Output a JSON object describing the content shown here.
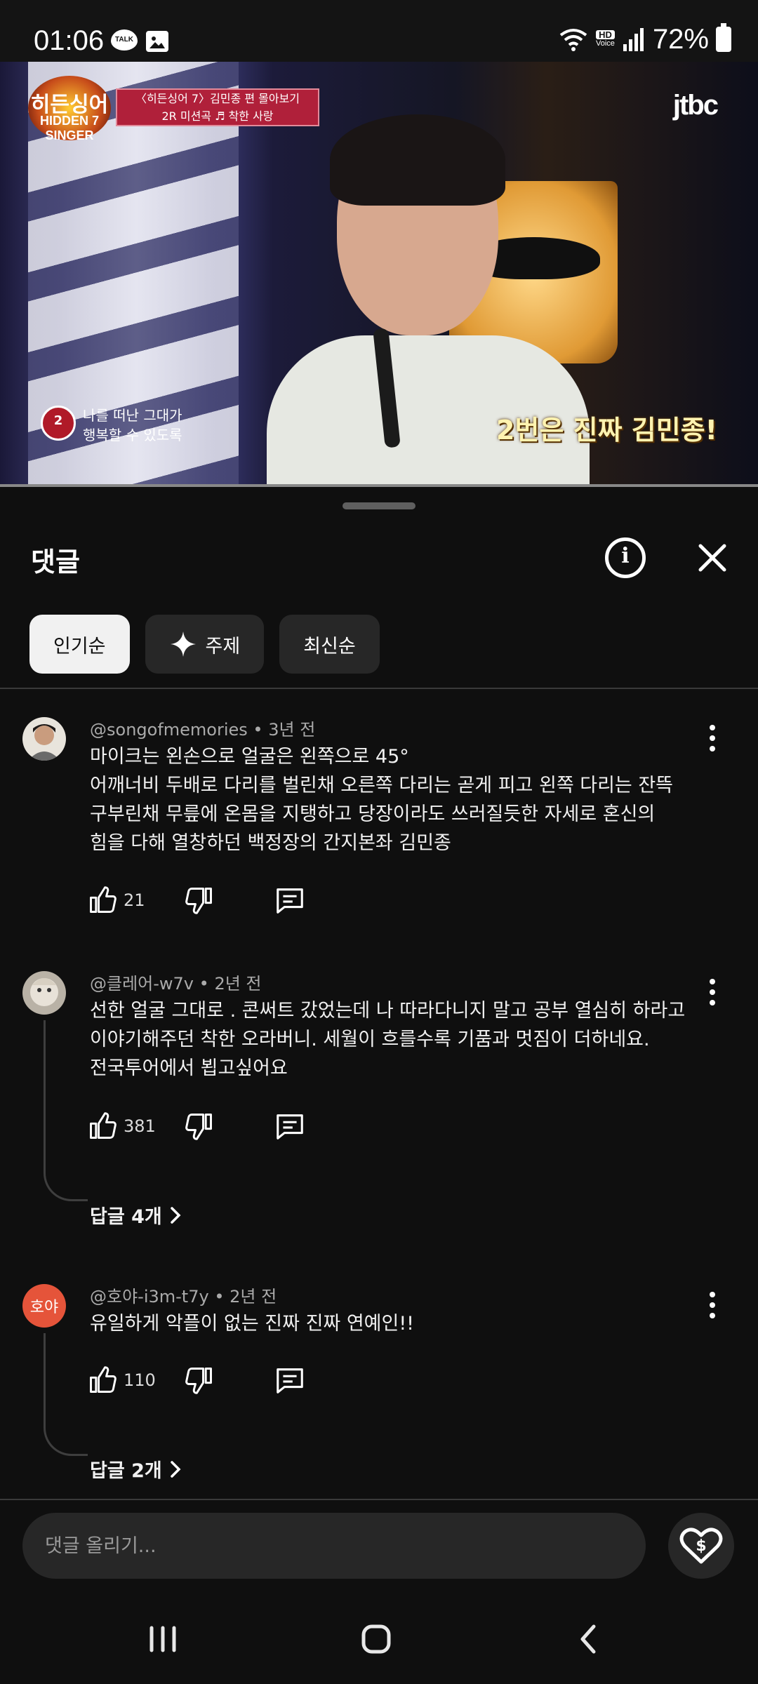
{
  "status_bar": {
    "time": "01:06",
    "talk_badge": "TALK",
    "hd_voice": "HD Voice",
    "battery": "72%"
  },
  "video": {
    "show_logo_line1": "히든싱어",
    "show_logo_line2": "HIDDEN 7 SINGER",
    "banner_line1": "〈히든싱어 7〉김민종 편 몰아보기",
    "banner_line2": "2R 미션곡 ♬ 착한 사랑",
    "channel": "jtbc",
    "lyric_number": "2",
    "lyric_line1": "나를 떠난 그대가",
    "lyric_line2": "행복할 수 있도록",
    "caption": "2번은 진짜 김민종!"
  },
  "comments_panel": {
    "title": "댓글",
    "chips": [
      {
        "label": "인기순",
        "active": true
      },
      {
        "label": "주제",
        "active": false,
        "icon": "sparkle-icon"
      },
      {
        "label": "최신순",
        "active": false
      }
    ],
    "comments": [
      {
        "handle": "@songofmemories",
        "time": "3년 전",
        "text_lines": [
          "마이크는 왼손으로 얼굴은 왼쪽으로 45°",
          "어깨너비 두배로 다리를 벌린채 오른쪽 다리는 곧게 피고 왼쪽 다리는 잔뜩",
          "구부린채 무릎에 온몸을 지탱하고 당장이라도 쓰러질듯한 자세로 혼신의",
          "힘을  다해 열창하던 백정장의 간지본좌 김민종"
        ],
        "likes": "21",
        "replies": ""
      },
      {
        "handle": "@클레어-w7v",
        "time": "2년 전",
        "text_lines": [
          "선한 얼굴 그대로 . 콘써트 갔었는데 나 따라다니지 말고 공부 열심히 하라고",
          "이야기해주던 착한 오라버니. 세월이 흐를수록 기품과 멋짐이 더하네요.",
          "전국투어에서 뵙고싶어요"
        ],
        "likes": "381",
        "replies": "답글 4개"
      },
      {
        "handle": "@호야-i3m-t7y",
        "time": "2년 전",
        "avatar_text": "호야",
        "text_lines": [
          "유일하게 악플이 없는 진짜 진짜 연예인!!"
        ],
        "likes": "110",
        "replies": "답글 2개"
      }
    ],
    "input_placeholder": "댓글 올리기..."
  },
  "colors": {
    "background": "#0f0f0f",
    "chip_bg": "#272727",
    "chip_active_bg": "#f1f1f1",
    "avatar_hoya": "#e5543a"
  }
}
